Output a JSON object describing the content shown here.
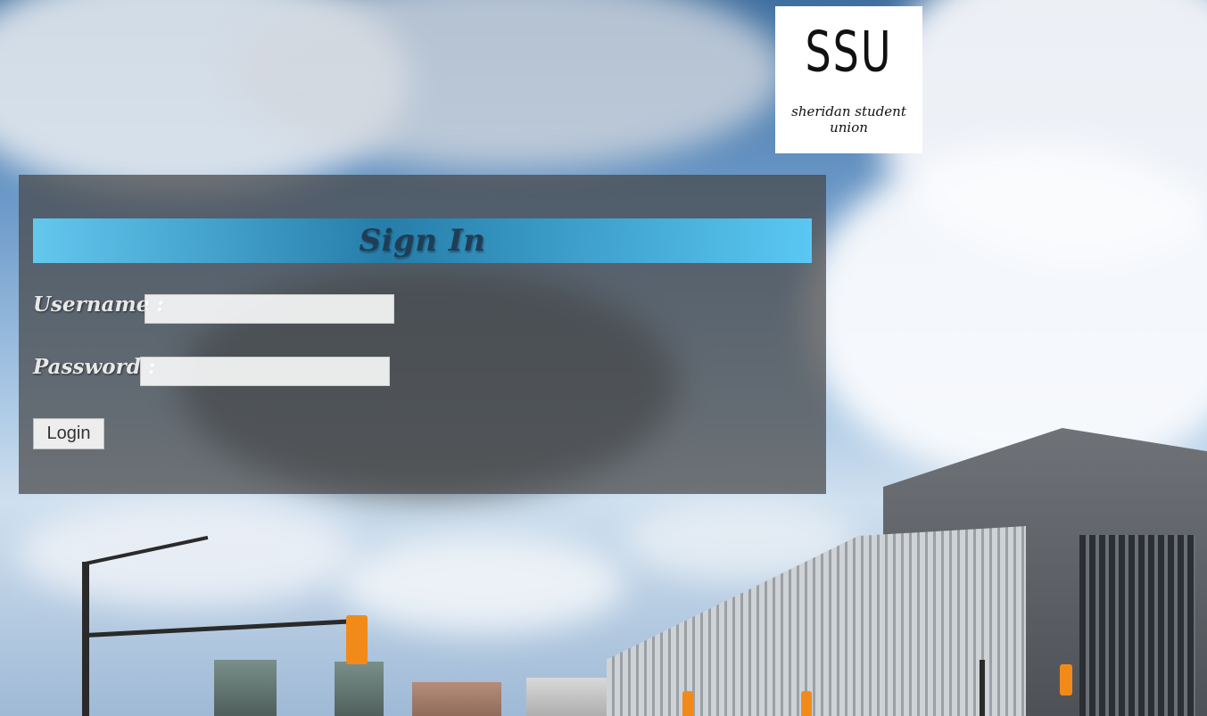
{
  "logo": {
    "mark": "SSU",
    "text": "sheridan student union"
  },
  "login_form": {
    "title": "Sign In",
    "username_label": "Username :",
    "username_value": "",
    "password_label": "Password :",
    "password_value": "",
    "login_button": "Login"
  },
  "colors": {
    "panel_background": "#464646",
    "header_accent": "#5acdfa",
    "title_text": "#1f3e55"
  }
}
